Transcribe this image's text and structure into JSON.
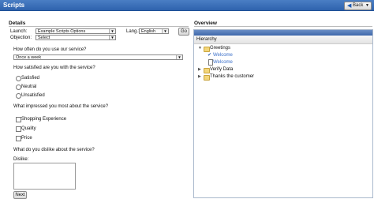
{
  "titlebar": {
    "title": "Scripts",
    "back_label": "Back"
  },
  "details": {
    "section_title": "Details",
    "launch_label": "Launch:",
    "launch_value": "Example Scripts Options",
    "lang_label": "Lang.:",
    "lang_value": "English",
    "go_label": "Go",
    "objection_label": "Objection:",
    "objection_value": "Select"
  },
  "questions": {
    "q1": "How often do you use our service?",
    "q1_value": "Once a week",
    "q2": "How satisfied are you with the service?",
    "q2_options": [
      "Satisfied",
      "Neutral",
      "Unsatisfied"
    ],
    "q3": "What impressed you most about the service?",
    "q3_options": [
      "Shopping Experience",
      "Quality",
      "Price"
    ],
    "q4": "What do you dislike about the service?",
    "dislike_label": "Dislike:",
    "next_label": "Next"
  },
  "overview": {
    "section_title": "Overview",
    "hierarchy_label": "Hierarchy",
    "tree": [
      {
        "label": "Greetings"
      },
      {
        "label": "Welcome"
      },
      {
        "label": "Welcome"
      },
      {
        "label": "Verify Data"
      },
      {
        "label": "Thanks the customer"
      }
    ]
  }
}
